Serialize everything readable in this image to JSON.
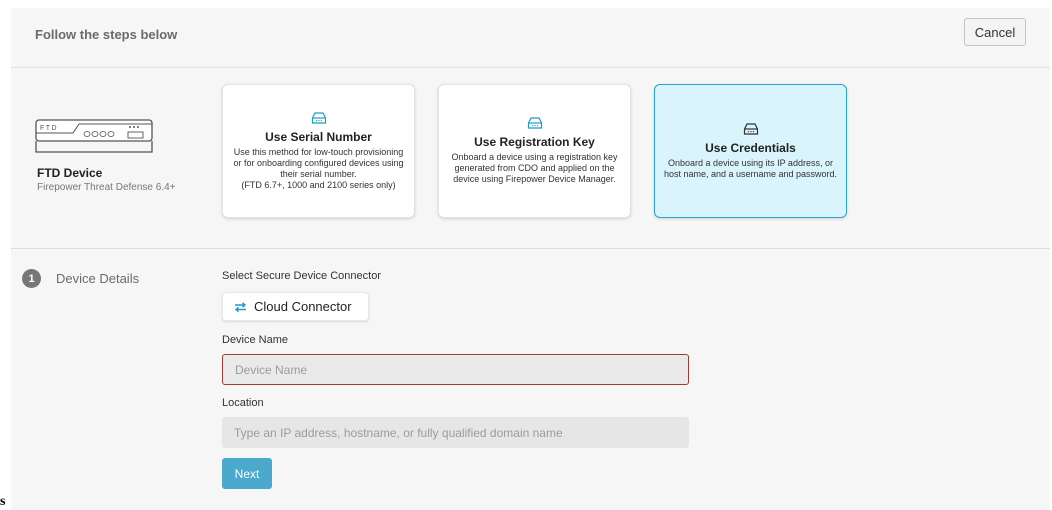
{
  "header": {
    "title": "Follow the steps below",
    "cancel_label": "Cancel"
  },
  "device": {
    "illustration_label": "FTD",
    "name": "FTD Device",
    "subtitle": "Firepower Threat Defense 6.4+"
  },
  "methods": [
    {
      "title": "Use Serial Number",
      "description": "Use this method for low-touch provisioning or for onboarding configured devices using their serial number.",
      "note": "(FTD 6.7+, 1000 and 2100 series only)",
      "icon": "device-icon",
      "selected": false
    },
    {
      "title": "Use Registration Key",
      "description": "Onboard a device using a registration key generated from CDO and applied on the device using Firepower Device Manager.",
      "icon": "device-icon",
      "selected": false
    },
    {
      "title": "Use Credentials",
      "description": "Onboard a device using its IP address, or host name, and a username and password.",
      "icon": "device-icon",
      "selected": true
    }
  ],
  "step": {
    "number": "1",
    "label": "Device Details"
  },
  "form": {
    "sdc_label": "Select Secure Device Connector",
    "sdc_value": "Cloud Connector",
    "device_name_label": "Device Name",
    "device_name_placeholder": "Device Name",
    "location_label": "Location",
    "location_placeholder": "Type an IP address, hostname, or fully qualified domain name",
    "next_label": "Next"
  },
  "stray_text": "s",
  "colors": {
    "accent": "#2aa4ce",
    "selected_card_bg": "#d9f4fc",
    "next_button": "#4aa9cc",
    "error_border": "#a33a3a",
    "panel_bg": "#f6f6f6"
  }
}
